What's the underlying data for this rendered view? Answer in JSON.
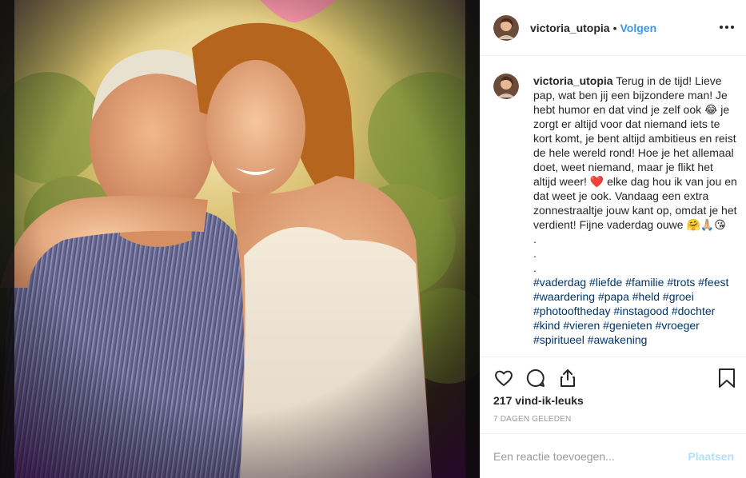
{
  "post": {
    "photo_alt": "",
    "author": {
      "username": "victoria_utopia",
      "separator": "•",
      "follow_label": "Volgen",
      "avatar": "avatar-photo-icon"
    },
    "more_icon": "more-options-icon",
    "caption": {
      "username": "victoria_utopia",
      "text": "Terug in de tijd! Lieve pap, wat ben jij een bijzondere man! Je hebt humor en dat vind je zelf ook 😂 je zorgt er altijd voor dat niemand iets te kort komt, je bent altijd ambitieus en reist de hele wereld rond! Hoe je het allemaal doet, weet niemand, maar je flikt het altijd weer! ❤️ elke dag hou ik van jou en dat weet je ook. Vandaag een extra zonnestraaltje jouw kant op, omdat je het verdient! Fijne vaderdag ouwe 🤗🙏🏼😘",
      "dots": [
        ".",
        ".",
        "."
      ],
      "hashtags": "#vaderdag #liefde #familie #trots #feest #waardering #papa #held #groei #photooftheday #instagood #dochter #kind #vieren #genieten #vroeger #spiritueel #awakening"
    },
    "actions": {
      "like_icon": "heart-icon",
      "comment_icon": "comment-bubble-icon",
      "share_icon": "share-icon",
      "save_icon": "bookmark-icon"
    },
    "likes_label": "217 vind-ik-leuks",
    "timestamp": "7 DAGEN GELEDEN",
    "comment_box": {
      "placeholder": "Een reactie toevoegen...",
      "post_label": "Plaatsen"
    }
  },
  "colors": {
    "link_blue": "#3897f0",
    "hashtag_blue": "#003569",
    "post_disabled": "#b2dffc",
    "muted": "#999999",
    "border": "#efefef"
  }
}
